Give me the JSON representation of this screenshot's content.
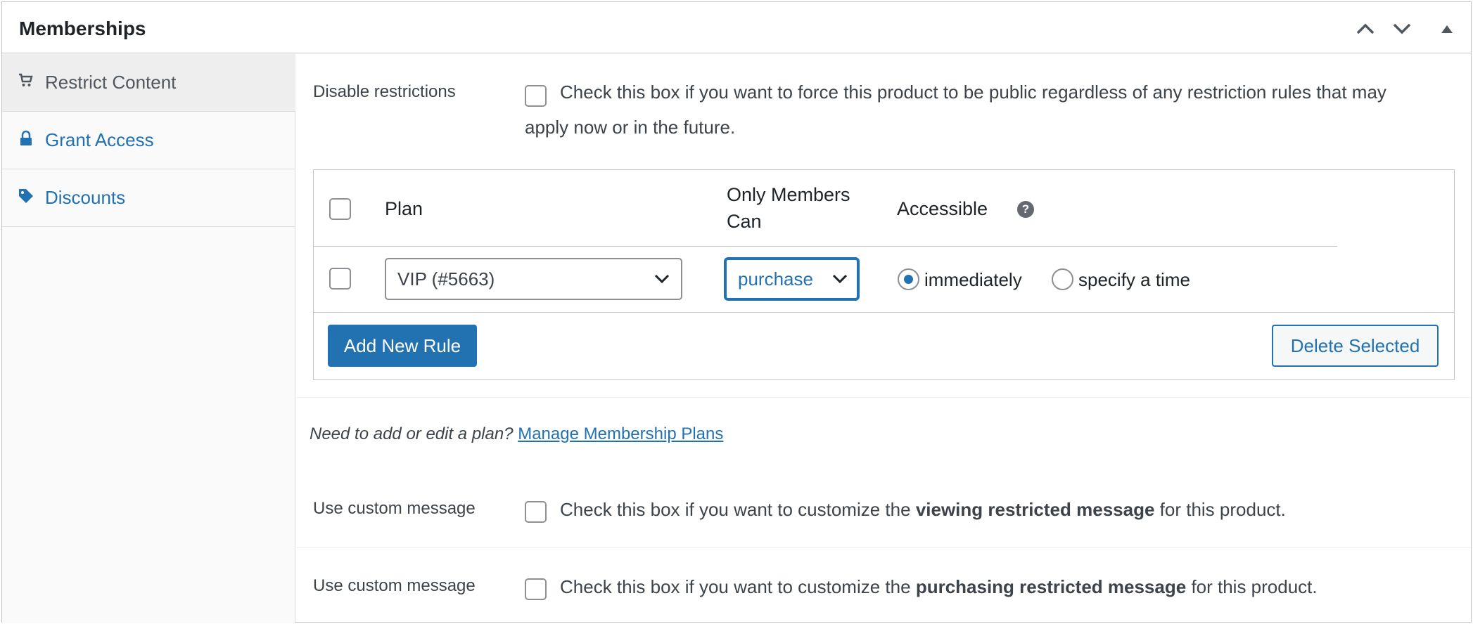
{
  "panel": {
    "title": "Memberships",
    "controls": {
      "move_up": "chevron-up-icon",
      "move_down": "chevron-down-icon",
      "toggle": "triangle-up-icon"
    }
  },
  "sidebar": {
    "items": [
      {
        "label": "Restrict Content",
        "icon": "cart-icon",
        "active": true
      },
      {
        "label": "Grant Access",
        "icon": "lock-icon",
        "active": false
      },
      {
        "label": "Discounts",
        "icon": "tag-icon",
        "active": false
      }
    ]
  },
  "restrictions": {
    "label": "Disable restrictions",
    "description_line1": "Check this box if you want to force this product to be public regardless of any restriction rules that may",
    "description_line2": "apply now or in the future.",
    "checked": false
  },
  "rules_table": {
    "headers": {
      "plan": "Plan",
      "only_members_line1": "Only Members",
      "only_members_line2": "Can",
      "accessible": "Accessible",
      "help": "?"
    },
    "row": {
      "plan_value": "VIP (#5663)",
      "action_value": "purchase",
      "radio_immediately": "immediately",
      "radio_specify": "specify a time",
      "selected": "immediately"
    },
    "add_button": "Add New Rule",
    "delete_button": "Delete Selected"
  },
  "note": {
    "text": "Need to add or edit a plan?",
    "link": "Manage Membership Plans"
  },
  "custom_messages": [
    {
      "label": "Use custom message",
      "prefix": "Check this box if you want to customize the",
      "bold": "viewing restricted message",
      "suffix": "for this product."
    },
    {
      "label": "Use custom message",
      "prefix": "Check this box if you want to customize the",
      "bold": "purchasing restricted message",
      "suffix": "for this product."
    }
  ],
  "colors": {
    "accent": "#2271b1",
    "border": "#c3c4c7",
    "text": "#3c434a"
  }
}
